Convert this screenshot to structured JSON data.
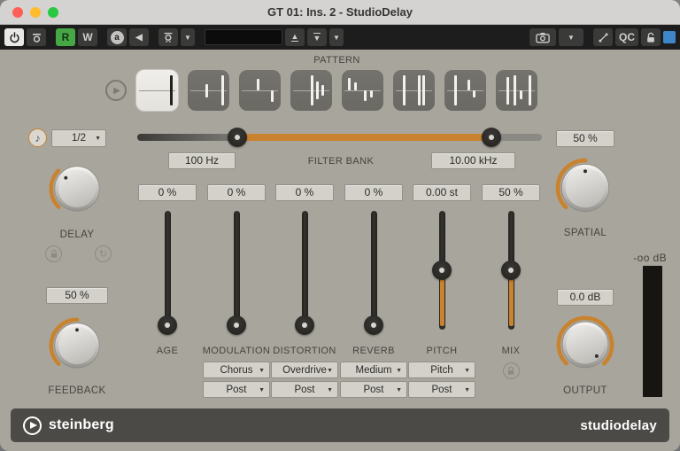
{
  "window": {
    "title": "GT 01: Ins. 2 - StudioDelay"
  },
  "toolbar": {
    "read_label": "R",
    "write_label": "W",
    "ab_label": "a",
    "qc_label": "QC",
    "preset_name": ""
  },
  "pattern": {
    "label": "PATTERN",
    "selected_index": 0,
    "buttons": [
      {
        "taps": [
          {
            "x": 0.82,
            "dir": "both",
            "len": 1.0
          }
        ]
      },
      {
        "taps": [
          {
            "x": 0.45,
            "dir": "both",
            "len": 0.45
          },
          {
            "x": 0.82,
            "dir": "both",
            "len": 1.0
          }
        ]
      },
      {
        "taps": [
          {
            "x": 0.45,
            "dir": "up",
            "len": 0.75
          },
          {
            "x": 0.78,
            "dir": "down",
            "len": 0.75
          }
        ]
      },
      {
        "taps": [
          {
            "x": 0.5,
            "dir": "both",
            "len": 1.0
          },
          {
            "x": 0.64,
            "dir": "both",
            "len": 0.6
          },
          {
            "x": 0.76,
            "dir": "both",
            "len": 0.35
          }
        ]
      },
      {
        "taps": [
          {
            "x": 0.18,
            "dir": "up",
            "len": 0.85
          },
          {
            "x": 0.32,
            "dir": "up",
            "len": 0.5
          },
          {
            "x": 0.56,
            "dir": "down",
            "len": 0.7
          },
          {
            "x": 0.71,
            "dir": "down",
            "len": 0.45
          }
        ]
      },
      {
        "taps": [
          {
            "x": 0.25,
            "dir": "both",
            "len": 1.0
          },
          {
            "x": 0.62,
            "dir": "both",
            "len": 1.0
          },
          {
            "x": 0.73,
            "dir": "both",
            "len": 1.0
          }
        ]
      },
      {
        "taps": [
          {
            "x": 0.25,
            "dir": "both",
            "len": 1.0
          },
          {
            "x": 0.58,
            "dir": "up",
            "len": 0.7
          },
          {
            "x": 0.7,
            "dir": "down",
            "len": 0.45
          }
        ]
      },
      {
        "taps": [
          {
            "x": 0.27,
            "dir": "both",
            "len": 0.9
          },
          {
            "x": 0.45,
            "dir": "both",
            "len": 1.0
          },
          {
            "x": 0.6,
            "dir": "down",
            "len": 0.6
          },
          {
            "x": 0.8,
            "dir": "both",
            "len": 1.0
          }
        ]
      }
    ]
  },
  "filter_bank": {
    "label": "FILTER BANK",
    "low_value": "100 Hz",
    "high_value": "10.00 kHz",
    "low_pos_pct": 24.7,
    "high_pos_pct": 87.5
  },
  "delay": {
    "label": "DELAY",
    "sync_value": "1/2",
    "knob_percent": 33
  },
  "feedback": {
    "label": "FEEDBACK",
    "value": "50 %",
    "knob_percent": 50
  },
  "spatial": {
    "label": "SPATIAL",
    "value": "50 %",
    "knob_percent": 50
  },
  "output": {
    "label": "OUTPUT",
    "value": "0.0 dB",
    "knob_percent": 100,
    "meter_label": "-oo dB"
  },
  "sliders": [
    {
      "name": "AGE",
      "value": "0 %",
      "percent": 0
    },
    {
      "name": "MODULATION",
      "value": "0 %",
      "percent": 0,
      "type": "Chorus",
      "routing": "Post"
    },
    {
      "name": "DISTORTION",
      "value": "0 %",
      "percent": 0,
      "type": "Overdrive",
      "routing": "Post"
    },
    {
      "name": "REVERB",
      "value": "0 %",
      "percent": 0,
      "type": "Medium",
      "routing": "Post"
    },
    {
      "name": "PITCH",
      "value": "0.00 st",
      "percent": 50,
      "type": "Pitch",
      "routing": "Post"
    },
    {
      "name": "MIX",
      "value": "50 %",
      "percent": 50,
      "locked": true
    }
  ],
  "footer": {
    "brand": "steinberg",
    "product": "studiodelay"
  },
  "colors": {
    "accent": "#c9822e",
    "focus_blue": "#3e86c8",
    "record_green": "#45a845"
  }
}
